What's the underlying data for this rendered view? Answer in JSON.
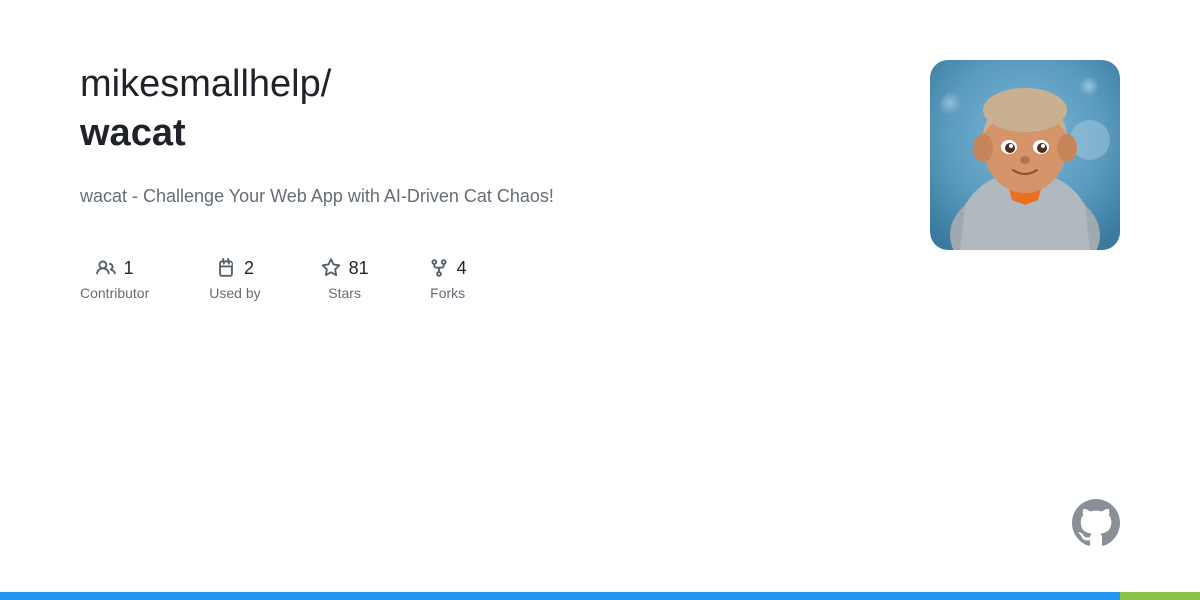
{
  "repo": {
    "owner": "mikesmallhelp/",
    "name": "wacat",
    "description": "wacat - Challenge Your Web App with AI-Driven Cat Chaos!",
    "stats": {
      "contributors": {
        "count": "1",
        "label": "Contributor"
      },
      "used_by": {
        "count": "2",
        "label": "Used by"
      },
      "stars": {
        "count": "81",
        "label": "Stars"
      },
      "forks": {
        "count": "4",
        "label": "Forks"
      }
    }
  },
  "colors": {
    "bottom_blue": "#2196F3",
    "bottom_green": "#8BC34A"
  }
}
